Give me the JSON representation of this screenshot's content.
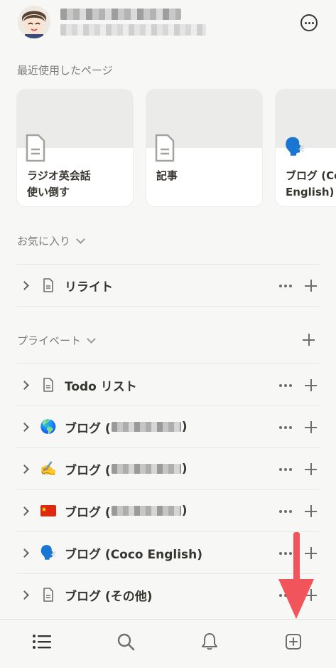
{
  "recent": {
    "title": "最近使用したページ",
    "cards": [
      {
        "title": "ラジオ英会話\n使い倒す",
        "icon": "document-icon"
      },
      {
        "title": "記事",
        "icon": "document-icon"
      },
      {
        "title": "ブログ (Coco\nEnglish)",
        "icon": "speaking-head-emoji",
        "emoji": "🗣️"
      }
    ]
  },
  "favorites": {
    "title": "お気に入り",
    "items": [
      {
        "label": "リライト",
        "icon": "document-icon"
      }
    ]
  },
  "private": {
    "title": "プライベート",
    "items": [
      {
        "label": "Todo リスト",
        "icon": "document-icon"
      },
      {
        "label_prefix": "ブログ (",
        "label_suffix": ")",
        "emoji": "🌎",
        "icon": "globe-emoji",
        "redacted": true
      },
      {
        "label_prefix": "ブログ (",
        "label_suffix": ")",
        "emoji": "✍️",
        "icon": "writing-hand-emoji",
        "redacted": true
      },
      {
        "label_prefix": "ブログ (",
        "label_suffix": ")",
        "emoji": "🇨🇳",
        "icon": "china-flag-emoji",
        "redacted": true
      },
      {
        "label": "ブログ (Coco English)",
        "emoji": "🗣️",
        "icon": "speaking-head-emoji"
      },
      {
        "label": "ブログ (その他)",
        "icon": "document-icon"
      }
    ]
  },
  "tabbar": {
    "items": [
      {
        "icon": "list-icon"
      },
      {
        "icon": "search-icon"
      },
      {
        "icon": "bell-icon"
      },
      {
        "icon": "new-page-icon"
      }
    ]
  },
  "colors": {
    "background": "#f7f7f5",
    "text": "#37352f",
    "muted": "#7d7c78",
    "arrow": "#f2545b"
  }
}
